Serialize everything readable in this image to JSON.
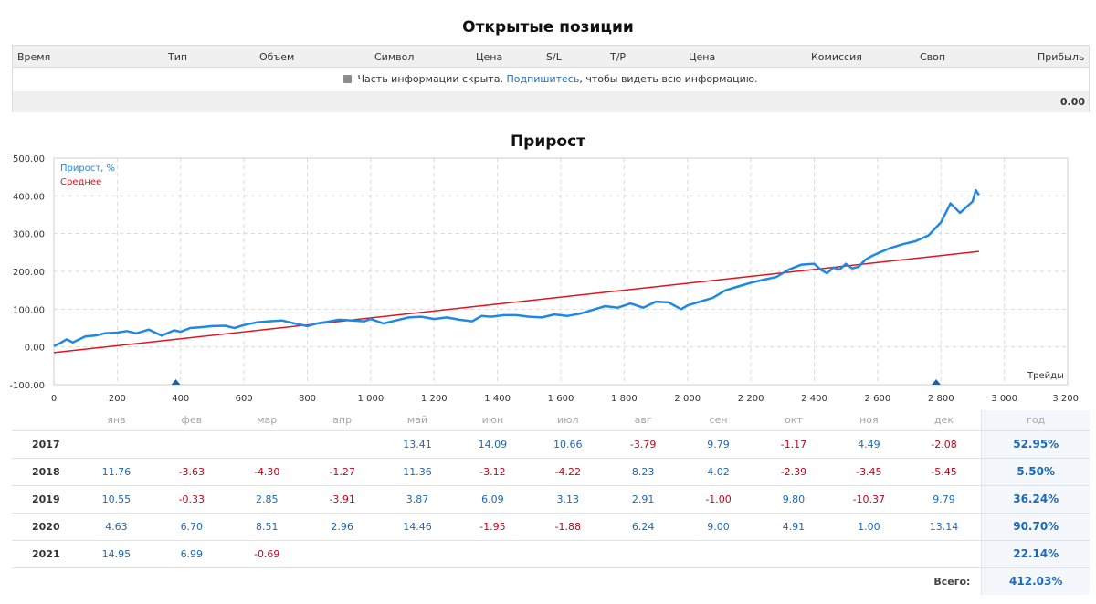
{
  "positions": {
    "title": "Открытые позиции",
    "columns": [
      "Время",
      "Тип",
      "Объем",
      "Символ",
      "Цена",
      "S/L",
      "T/P",
      "Цена",
      "Комиссия",
      "Своп",
      "Прибыль"
    ],
    "notice_before": "Часть информации скрыта.",
    "notice_link": "Подпишитесь",
    "notice_after": ", чтобы видеть всю информацию.",
    "total_profit": "0.00"
  },
  "growth": {
    "title": "Прирост"
  },
  "colors": {
    "growth_line": "#1e88e5",
    "average_line": "#e0141e",
    "positive": "#1b69b6",
    "negative": "#c4041b"
  },
  "chart_data": {
    "type": "line",
    "xlabel": "Трейды",
    "xlim": [
      0,
      3200
    ],
    "ylim": [
      -100,
      500
    ],
    "x_ticks": [
      "0",
      "200",
      "400",
      "600",
      "800",
      "1 000",
      "1 200",
      "1 400",
      "1 600",
      "1 800",
      "2 000",
      "2 200",
      "2 400",
      "2 600",
      "2 800",
      "3 000",
      "3 200"
    ],
    "x_tick_values": [
      0,
      200,
      400,
      600,
      800,
      1000,
      1200,
      1400,
      1600,
      1800,
      2000,
      2200,
      2400,
      2600,
      2800,
      3000,
      3200
    ],
    "y_ticks": [
      "500.00",
      "400.00",
      "300.00",
      "200.00",
      "100.00",
      "0.00",
      "-100.00"
    ],
    "y_tick_values": [
      500,
      400,
      300,
      200,
      100,
      0,
      -100
    ],
    "grid": true,
    "legend_position": "top-left",
    "markers": [
      385,
      2785
    ],
    "series": [
      {
        "name": "Прирост, %",
        "x": [
          0,
          20,
          40,
          60,
          80,
          100,
          130,
          160,
          200,
          230,
          260,
          300,
          340,
          380,
          400,
          430,
          460,
          500,
          540,
          570,
          600,
          640,
          680,
          720,
          760,
          800,
          830,
          860,
          900,
          940,
          980,
          1000,
          1040,
          1080,
          1120,
          1160,
          1200,
          1240,
          1280,
          1320,
          1350,
          1380,
          1420,
          1460,
          1500,
          1540,
          1580,
          1620,
          1660,
          1700,
          1740,
          1780,
          1820,
          1860,
          1900,
          1940,
          1980,
          2000,
          2040,
          2080,
          2120,
          2160,
          2200,
          2240,
          2280,
          2320,
          2360,
          2400,
          2420,
          2440,
          2460,
          2480,
          2500,
          2520,
          2540,
          2560,
          2580,
          2600,
          2640,
          2680,
          2720,
          2760,
          2800,
          2830,
          2860,
          2880,
          2900,
          2910,
          2920
        ],
        "y": [
          2,
          10,
          20,
          12,
          20,
          28,
          30,
          36,
          38,
          42,
          36,
          46,
          30,
          44,
          40,
          50,
          52,
          55,
          56,
          50,
          58,
          65,
          68,
          70,
          62,
          55,
          62,
          66,
          72,
          70,
          68,
          74,
          62,
          70,
          78,
          80,
          74,
          78,
          72,
          68,
          82,
          80,
          84,
          84,
          80,
          78,
          86,
          82,
          88,
          98,
          108,
          104,
          115,
          104,
          120,
          118,
          100,
          110,
          120,
          130,
          150,
          160,
          170,
          178,
          185,
          205,
          218,
          220,
          205,
          195,
          210,
          205,
          220,
          208,
          212,
          230,
          240,
          248,
          262,
          272,
          280,
          295,
          330,
          380,
          355,
          370,
          385,
          415,
          402
        ],
        "color": "#1e88e5"
      },
      {
        "name": "Среднее",
        "x": [
          0,
          2920
        ],
        "y": [
          -15,
          253
        ],
        "color": "#e0141e"
      }
    ]
  },
  "monthly": {
    "months": [
      "янв",
      "фев",
      "мар",
      "апр",
      "май",
      "июн",
      "июл",
      "авг",
      "сен",
      "окт",
      "ноя",
      "дек"
    ],
    "year_label": "год",
    "total_label": "Всего:",
    "total_value": "412.03%",
    "rows": [
      {
        "year": "2017",
        "values": [
          "",
          "",
          "",
          "",
          "13.41",
          "14.09",
          "10.66",
          "-3.79",
          "9.79",
          "-1.17",
          "4.49",
          "-2.08"
        ],
        "total": "52.95%"
      },
      {
        "year": "2018",
        "values": [
          "11.76",
          "-3.63",
          "-4.30",
          "-1.27",
          "11.36",
          "-3.12",
          "-4.22",
          "8.23",
          "4.02",
          "-2.39",
          "-3.45",
          "-5.45"
        ],
        "total": "5.50%"
      },
      {
        "year": "2019",
        "values": [
          "10.55",
          "-0.33",
          "2.85",
          "-3.91",
          "3.87",
          "6.09",
          "3.13",
          "2.91",
          "-1.00",
          "9.80",
          "-10.37",
          "9.79"
        ],
        "total": "36.24%"
      },
      {
        "year": "2020",
        "values": [
          "4.63",
          "6.70",
          "8.51",
          "2.96",
          "14.46",
          "-1.95",
          "-1.88",
          "6.24",
          "9.00",
          "4.91",
          "1.00",
          "13.14"
        ],
        "total": "90.70%"
      },
      {
        "year": "2021",
        "values": [
          "14.95",
          "6.99",
          "-0.69",
          "",
          "",
          "",
          "",
          "",
          "",
          "",
          "",
          ""
        ],
        "total": "22.14%"
      }
    ]
  }
}
